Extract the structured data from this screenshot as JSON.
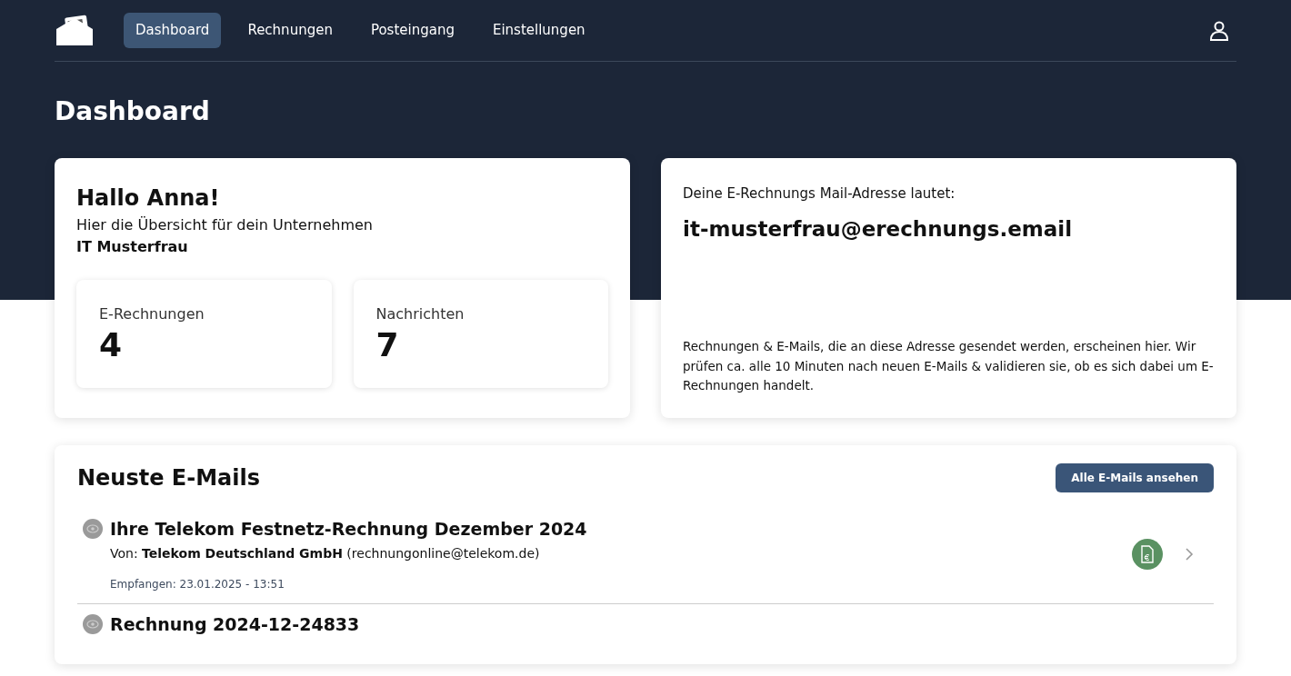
{
  "nav": {
    "items": [
      {
        "label": "Dashboard",
        "selected": true
      },
      {
        "label": "Rechnungen",
        "selected": false
      },
      {
        "label": "Posteingang",
        "selected": false
      },
      {
        "label": "Einstellungen",
        "selected": false
      }
    ]
  },
  "page_title": "Dashboard",
  "welcome": {
    "greeting": "Hallo Anna!",
    "subtitle": "Hier die Übersicht für dein Unternehmen",
    "company": "IT Musterfrau",
    "stats": [
      {
        "label": "E-Rechnungen",
        "value": "4"
      },
      {
        "label": "Nachrichten",
        "value": "7"
      }
    ]
  },
  "address_card": {
    "intro": "Deine E-Rechnungs Mail-Adresse lautet:",
    "address": "it-musterfrau@erechnungs.email",
    "note": "Rechnungen & E-Mails, die an diese Adresse gesendet werden, erscheinen hier. Wir prüfen ca. alle 10 Minuten nach neuen E-Mails & validieren sie, ob es sich dabei um E-Rechnungen handelt."
  },
  "emails": {
    "title": "Neuste E-Mails",
    "button": "Alle E-Mails ansehen",
    "items": [
      {
        "subject": "Ihre Telekom Festnetz-Rechnung Dezember 2024",
        "from": "Von: **Telekom Deutschland GmbH** (rechnungonline@telekom.de)",
        "received": "Empfangen: 23.01.2025 - 13:51",
        "is_invoice": true
      },
      {
        "subject": "Rechnung 2024-12-24833"
      }
    ]
  }
}
